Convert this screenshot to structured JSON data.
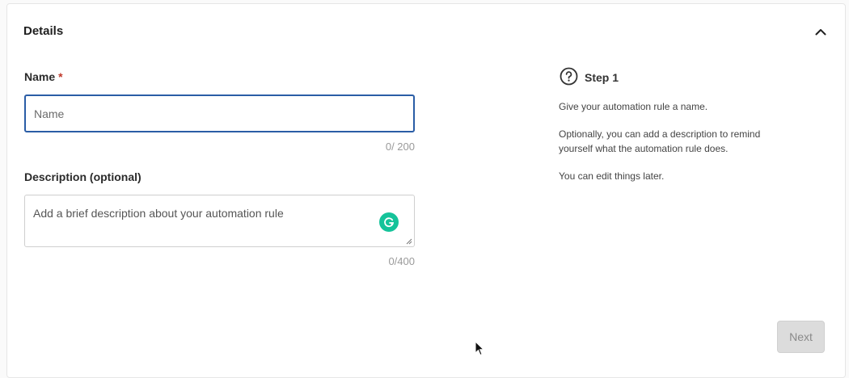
{
  "details": {
    "title": "Details",
    "collapse_icon": "chevron-up-icon"
  },
  "form": {
    "name": {
      "label": "Name",
      "required_mark": "*",
      "placeholder": "Name",
      "value": "",
      "counter": "0/ 200"
    },
    "description": {
      "label": "Description (optional)",
      "placeholder": "Add a brief description about your automation rule",
      "value": "",
      "counter": "0/400",
      "assistant_icon": "grammarly-icon"
    }
  },
  "help": {
    "icon": "question-circle-icon",
    "step_title": "Step 1",
    "lines": [
      "Give your automation rule a name.",
      "Optionally, you can add a description to remind",
      "yourself what the automation rule does.",
      "You can edit things later."
    ]
  },
  "actions": {
    "next_label": "Next",
    "next_enabled": false
  },
  "colors": {
    "input_focus_border": "#2a5da6",
    "required": "#c0392b",
    "grammarly": "#15c39a",
    "disabled_button_bg": "#dcdcdc"
  }
}
